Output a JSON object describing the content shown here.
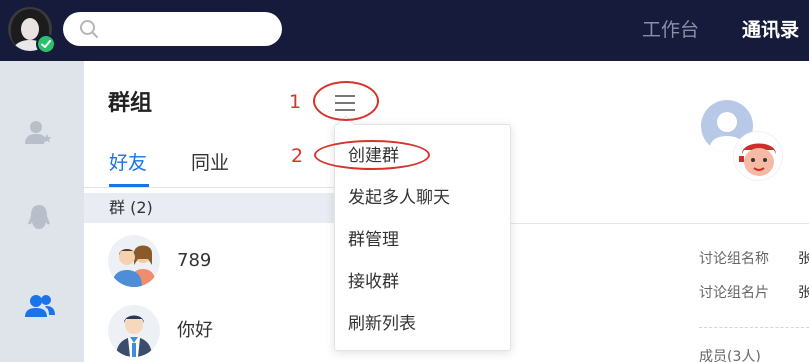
{
  "topbar": {
    "search": {
      "placeholder": "",
      "value": ""
    },
    "nav": {
      "workbench": "工作台",
      "contacts": "通讯录"
    }
  },
  "panel": {
    "title": "群组",
    "tabs": [
      {
        "label": "好友",
        "active": true
      },
      {
        "label": "同业",
        "active": false
      }
    ],
    "section_header": "群 (2)",
    "groups": [
      {
        "name": "789"
      },
      {
        "name": "你好"
      }
    ]
  },
  "menu": {
    "items": [
      "创建群",
      "发起多人聊天",
      "群管理",
      "接收群",
      "刷新列表"
    ]
  },
  "annotations": {
    "step1": "1",
    "step2": "2"
  },
  "detail": {
    "fields": [
      {
        "label": "讨论组名称",
        "value": "张"
      },
      {
        "label": "讨论组名片",
        "value": "张"
      }
    ],
    "members_label": "成员(3人)"
  },
  "colors": {
    "topbar": "#161b3b",
    "accent": "#1a73e8",
    "annotation": "#d9312b",
    "rail": "#dfe3ea",
    "online": "#2bc16b"
  }
}
